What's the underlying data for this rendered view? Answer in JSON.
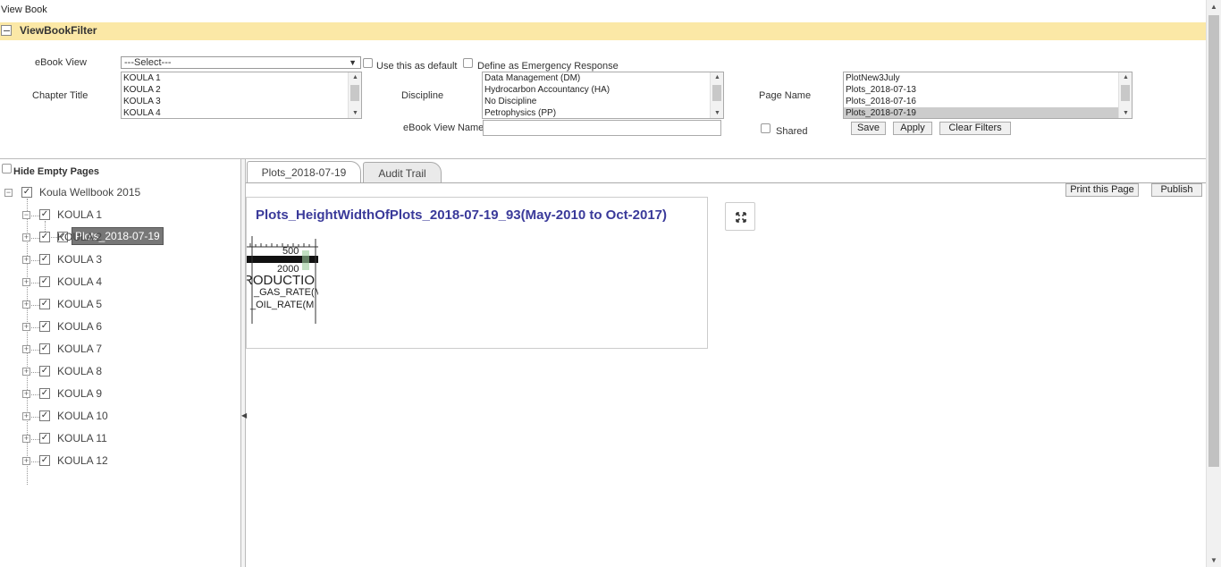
{
  "page": {
    "title": "View Book"
  },
  "filter": {
    "title": "ViewBookFilter",
    "ebook_view_label": "eBook View",
    "ebook_view_value": "---Select---",
    "use_default_label": "Use this as default",
    "emergency_label": "Define as Emergency Response",
    "chapter_title_label": "Chapter Title",
    "chapters": [
      "KOULA 1",
      "KOULA 2",
      "KOULA 3",
      "KOULA 4"
    ],
    "discipline_label": "Discipline",
    "disciplines": [
      "Data Management (DM)",
      "Hydrocarbon Accountancy (HA)",
      "No Discipline",
      "Petrophysics (PP)"
    ],
    "page_name_label": "Page Name",
    "pages": [
      "PlotNew3July",
      "Plots_2018-07-13",
      "Plots_2018-07-16",
      "Plots_2018-07-19"
    ],
    "selected_page_index": 3,
    "view_name_label": "eBook View Name",
    "view_name_value": "",
    "shared_label": "Shared",
    "save_label": "Save",
    "apply_label": "Apply",
    "clear_label": "Clear Filters"
  },
  "tree": {
    "hide_empty_label": "Hide Empty Pages",
    "root_label": "Koula Wellbook 2015",
    "selected_page_label": "Plots_2018-07-19",
    "items": [
      "KOULA 1",
      "KOULA 2",
      "KOULA 3",
      "KOULA 4",
      "KOULA 5",
      "KOULA 6",
      "KOULA 7",
      "KOULA 8",
      "KOULA 9",
      "KOULA 10",
      "KOULA 11",
      "KOULA 12"
    ]
  },
  "tabs": [
    {
      "label": "Plots_2018-07-19",
      "active": true
    },
    {
      "label": "Audit Trail",
      "active": false
    }
  ],
  "actions": {
    "print_label": "Print this Page",
    "publish_label": "Publish"
  },
  "content": {
    "plot_title": "Plots_HeightWidthOfPlots_2018-07-19_93(May-2010 to Oct-2017)",
    "plot_fragments": [
      "500",
      "2000",
      "RODUCTIO",
      "_GAS_RATE(M",
      "_OIL_RATE(M"
    ]
  },
  "colors": {
    "filter_bar": "#fbe8a6",
    "plot_title": "#3a3a9a",
    "selected_node": "#777777"
  },
  "icons": {
    "fullscreen": "expand-icon",
    "collapse": "minus-icon",
    "tree_expand": "plus-icon"
  }
}
